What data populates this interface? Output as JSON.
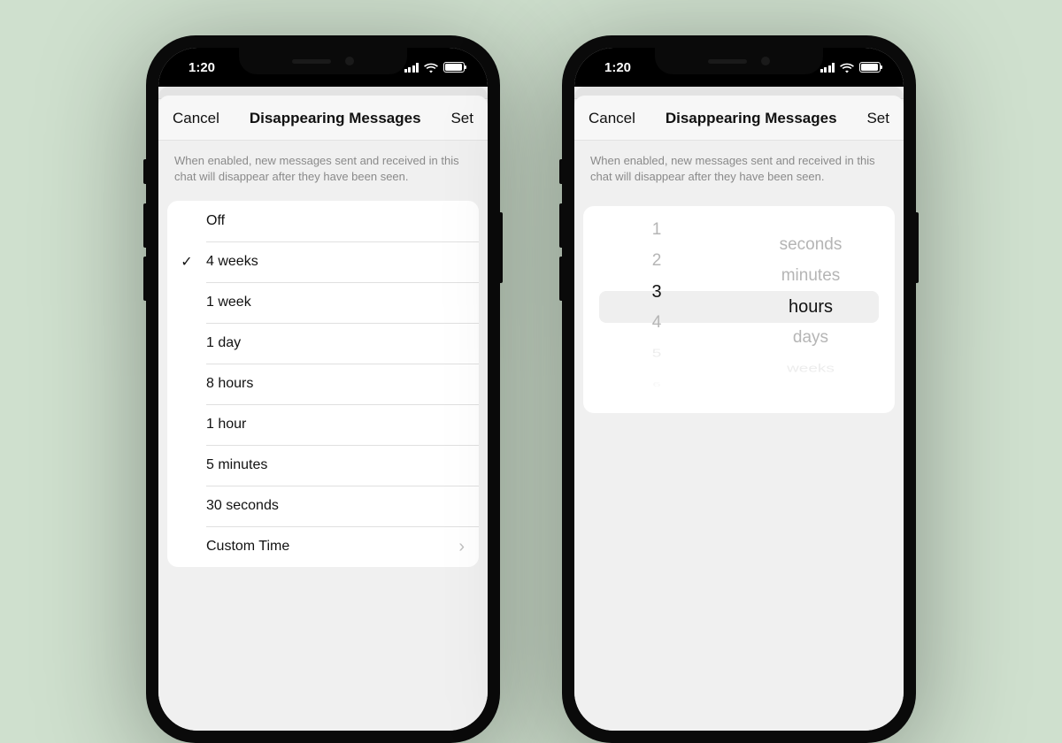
{
  "status": {
    "time": "1:20"
  },
  "sheet": {
    "left": "Cancel",
    "title": "Disappearing Messages",
    "right": "Set",
    "description": "When enabled, new messages sent and received in this chat will disappear after they have been seen."
  },
  "options": [
    {
      "label": "Off",
      "selected": false
    },
    {
      "label": "4 weeks",
      "selected": true
    },
    {
      "label": "1 week",
      "selected": false
    },
    {
      "label": "1 day",
      "selected": false
    },
    {
      "label": "8 hours",
      "selected": false
    },
    {
      "label": "1 hour",
      "selected": false
    },
    {
      "label": "5 minutes",
      "selected": false
    },
    {
      "label": "30 seconds",
      "selected": false
    },
    {
      "label": "Custom Time",
      "selected": false,
      "chevron": true
    }
  ],
  "picker": {
    "numbers": [
      "1",
      "2",
      "3",
      "4",
      "5",
      "6"
    ],
    "selected_number_index": 2,
    "units": [
      "seconds",
      "minutes",
      "hours",
      "days",
      "weeks"
    ],
    "selected_unit_index": 2
  }
}
